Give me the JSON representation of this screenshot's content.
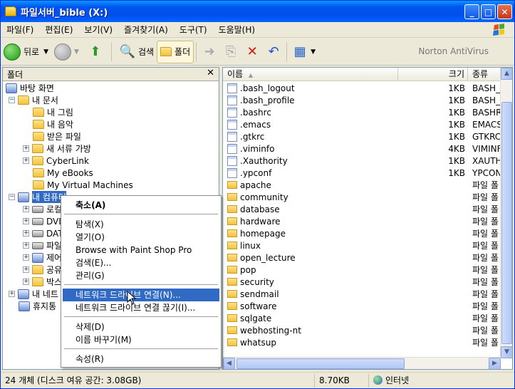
{
  "window": {
    "title": "파일서버_bible (X:)"
  },
  "menu": [
    "파일(F)",
    "편집(E)",
    "보기(V)",
    "즐겨찾기(A)",
    "도구(T)",
    "도움말(H)"
  ],
  "toolbar": {
    "back_label": "뒤로",
    "search_label": "검색",
    "folders_label": "폴더",
    "norton_label": "Norton AntiVirus"
  },
  "left_pane": {
    "header": "폴더",
    "tree": [
      {
        "label": "바탕 화면"
      },
      {
        "label": "내 문서"
      },
      {
        "label": "내 그림"
      },
      {
        "label": "내 음악"
      },
      {
        "label": "받은 파일"
      },
      {
        "label": "새 서류 가방"
      },
      {
        "label": "CyberLink"
      },
      {
        "label": "My eBooks"
      },
      {
        "label": "My Virtual Machines"
      },
      {
        "label": "내 컴퓨터"
      },
      {
        "label": "로컬"
      },
      {
        "label": "DVD"
      },
      {
        "label": "DAT"
      },
      {
        "label": "파일"
      },
      {
        "label": "제어"
      },
      {
        "label": "공유"
      },
      {
        "label": "박스"
      },
      {
        "label": "내 네트"
      },
      {
        "label": "휴지통"
      }
    ]
  },
  "columns": {
    "name": "이름",
    "size": "크기",
    "type": "종류"
  },
  "files": [
    {
      "name": ".bash_logout",
      "size": "1KB",
      "type": "BASH_",
      "kind": "file"
    },
    {
      "name": ".bash_profile",
      "size": "1KB",
      "type": "BASH_",
      "kind": "file"
    },
    {
      "name": ".bashrc",
      "size": "1KB",
      "type": "BASHR",
      "kind": "file"
    },
    {
      "name": ".emacs",
      "size": "1KB",
      "type": "EMACS",
      "kind": "file"
    },
    {
      "name": ".gtkrc",
      "size": "1KB",
      "type": "GTKRC",
      "kind": "file"
    },
    {
      "name": ".viminfo",
      "size": "4KB",
      "type": "VIMINF",
      "kind": "file"
    },
    {
      "name": ".Xauthority",
      "size": "1KB",
      "type": "XAUTH",
      "kind": "file"
    },
    {
      "name": ".ypconf",
      "size": "1KB",
      "type": "YPCON",
      "kind": "file"
    },
    {
      "name": "apache",
      "size": "",
      "type": "파일 폴",
      "kind": "folder"
    },
    {
      "name": "community",
      "size": "",
      "type": "파일 폴",
      "kind": "folder"
    },
    {
      "name": "database",
      "size": "",
      "type": "파일 폴",
      "kind": "folder"
    },
    {
      "name": "hardware",
      "size": "",
      "type": "파일 폴",
      "kind": "folder"
    },
    {
      "name": "homepage",
      "size": "",
      "type": "파일 폴",
      "kind": "folder"
    },
    {
      "name": "linux",
      "size": "",
      "type": "파일 폴",
      "kind": "folder"
    },
    {
      "name": "open_lecture",
      "size": "",
      "type": "파일 폴",
      "kind": "folder"
    },
    {
      "name": "pop",
      "size": "",
      "type": "파일 폴",
      "kind": "folder"
    },
    {
      "name": "security",
      "size": "",
      "type": "파일 폴",
      "kind": "folder"
    },
    {
      "name": "sendmail",
      "size": "",
      "type": "파일 폴",
      "kind": "folder"
    },
    {
      "name": "software",
      "size": "",
      "type": "파일 폴",
      "kind": "folder"
    },
    {
      "name": "sqlgate",
      "size": "",
      "type": "파일 폴",
      "kind": "folder"
    },
    {
      "name": "webhosting-nt",
      "size": "",
      "type": "파일 폴",
      "kind": "folder"
    },
    {
      "name": "whatsup",
      "size": "",
      "type": "파일 폴",
      "kind": "folder"
    }
  ],
  "context_menu": {
    "collapse": "축소(A)",
    "explore": "탐색(X)",
    "open": "열기(O)",
    "browse_psp": "Browse with Paint Shop Pro",
    "search": "검색(E)...",
    "manage": "관리(G)",
    "map_drive": "네트워크 드라이브 연결(N)...",
    "disconnect_drive": "네트워크 드라이브 연결 끊기(I)...",
    "delete": "삭제(D)",
    "rename": "이름 바꾸기(M)",
    "properties": "속성(R)"
  },
  "status": {
    "objects": "24 개체 (디스크 여유 공간: 3.08GB)",
    "size": "8.70KB",
    "zone": "인터넷"
  }
}
